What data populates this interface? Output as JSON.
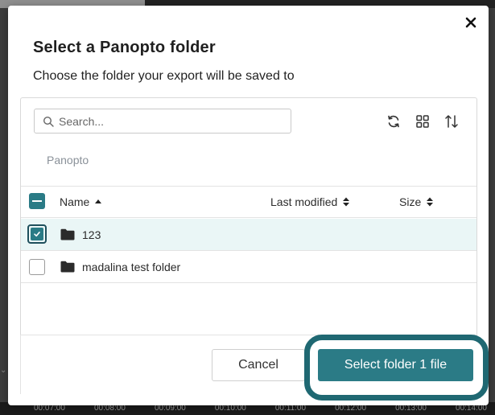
{
  "modal": {
    "title": "Select a Panopto folder",
    "subtitle": "Choose the folder your export will be saved to"
  },
  "search": {
    "placeholder": "Search..."
  },
  "toolbar": {
    "icons": [
      "refresh-icon",
      "grid-view-icon",
      "sort-icon"
    ]
  },
  "breadcrumb": "Panopto",
  "table": {
    "columns": {
      "name": "Name",
      "modified": "Last modified",
      "size": "Size"
    },
    "rows": [
      {
        "name": "123",
        "selected": true
      },
      {
        "name": "madalina test folder",
        "selected": false
      }
    ]
  },
  "footer": {
    "cancel_label": "Cancel",
    "select_label": "Select folder 1 file"
  },
  "background": {
    "timeline_ticks": [
      "00:07:00",
      "00:08:00",
      "00:09:00",
      "00:10:00",
      "00:11:00",
      "00:12:00",
      "00:13:00",
      "00:14:00"
    ]
  },
  "colors": {
    "accent": "#2b7b86",
    "accent_dark": "#1f6872",
    "selected_row": "#eaf6f6"
  }
}
